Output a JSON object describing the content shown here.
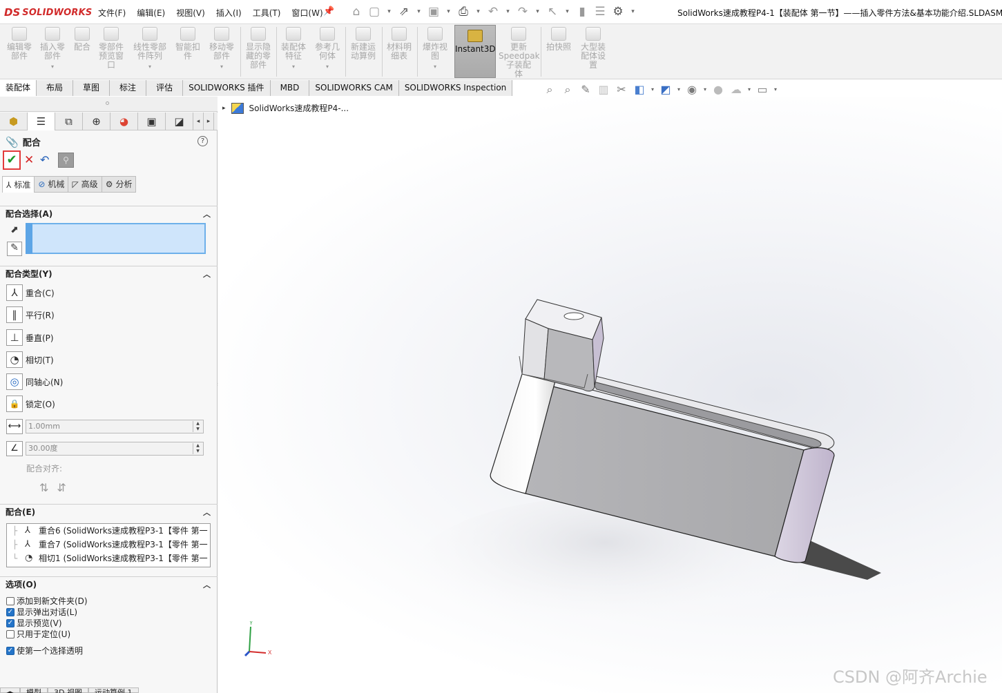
{
  "app": {
    "logo_ds": "DS",
    "logo_brand": "SOLIDWORKS",
    "document_title": "SolidWorks速成教程P4-1【装配体  第一节】——插入零件方法&基本功能介绍.SLDASM"
  },
  "menu": [
    {
      "label": "文件(F)"
    },
    {
      "label": "编辑(E)"
    },
    {
      "label": "视图(V)"
    },
    {
      "label": "插入(I)"
    },
    {
      "label": "工具(T)"
    },
    {
      "label": "窗口(W)"
    }
  ],
  "quickbar_icons": [
    "home-icon",
    "new-doc-icon",
    "open-icon",
    "save-icon",
    "print-icon",
    "undo-icon",
    "redo-icon",
    "select-icon",
    "rebuild-icon",
    "file-props-icon",
    "options-icon"
  ],
  "command_manager": {
    "commands": [
      {
        "label": "编辑零\n部件",
        "icon": "edit-component-icon"
      },
      {
        "label": "插入零\n部件",
        "icon": "insert-component-icon"
      },
      {
        "label": "配合",
        "icon": "mate-icon"
      },
      {
        "label": "零部件\n预览窗\n口",
        "icon": "preview-window-icon"
      },
      {
        "label": "线性零部\n件阵列",
        "icon": "linear-pattern-icon"
      },
      {
        "label": "智能扣\n件",
        "icon": "smart-fastener-icon"
      },
      {
        "label": "移动零\n部件",
        "icon": "move-component-icon"
      },
      {
        "label": "显示隐\n藏的零\n部件",
        "icon": "show-hidden-icon"
      },
      {
        "label": "装配体\n特征",
        "icon": "assembly-feature-icon"
      },
      {
        "label": "参考几\n何体",
        "icon": "reference-geometry-icon"
      },
      {
        "label": "新建运\n动算例",
        "icon": "motion-study-icon"
      },
      {
        "label": "材料明\n细表",
        "icon": "bom-icon"
      },
      {
        "label": "爆炸视\n图",
        "icon": "explode-icon"
      },
      {
        "label": "Instant3D",
        "icon": "instant3d-icon"
      },
      {
        "label": "更新\nSpeedpak\n子装配\n体",
        "icon": "speedpak-icon"
      },
      {
        "label": "拍快照",
        "icon": "snapshot-icon"
      },
      {
        "label": "大型装\n配体设\n置",
        "icon": "large-assembly-icon"
      }
    ],
    "tabs": [
      {
        "label": "装配体",
        "active": true
      },
      {
        "label": "布局"
      },
      {
        "label": "草图"
      },
      {
        "label": "标注"
      },
      {
        "label": "评估"
      },
      {
        "label": "SOLIDWORKS 插件"
      },
      {
        "label": "MBD"
      },
      {
        "label": "SOLIDWORKS CAM"
      },
      {
        "label": "SOLIDWORKS Inspection"
      }
    ]
  },
  "hud_icons": [
    "zoom-fit-icon",
    "zoom-area-icon",
    "previous-view-icon",
    "section-view-icon",
    "dynamic-annotation-icon",
    "view-orientation-icon",
    "display-style-icon",
    "hide-show-icon",
    "edit-appearance-icon",
    "apply-scene-icon",
    "view-settings-icon"
  ],
  "property_manager": {
    "title": "配合",
    "help": "?",
    "ok_symbol": "✔",
    "cancel_symbol": "✕",
    "undo_symbol": "↶",
    "pin_symbol": "⚲",
    "mate_tabs": [
      {
        "label": "标准",
        "active": true,
        "icon": "standard-mates-icon"
      },
      {
        "label": "机械",
        "icon": "mechanical-mates-icon"
      },
      {
        "label": "高级",
        "icon": "advanced-mates-icon"
      },
      {
        "label": "分析",
        "icon": "analysis-icon"
      }
    ],
    "selection_group": "配合选择(A)",
    "type_group": "配合类型(Y)",
    "mate_types": [
      {
        "label": "重合(C)",
        "icon": "coincident-icon",
        "glyph": "⅄"
      },
      {
        "label": "平行(R)",
        "icon": "parallel-icon",
        "glyph": "∥"
      },
      {
        "label": "垂直(P)",
        "icon": "perpendicular-icon",
        "glyph": "⊥"
      },
      {
        "label": "相切(T)",
        "icon": "tangent-icon",
        "glyph": "◔"
      },
      {
        "label": "同轴心(N)",
        "icon": "concentric-icon",
        "glyph": "◎"
      },
      {
        "label": "锁定(O)",
        "icon": "lock-icon",
        "glyph": "🔒"
      }
    ],
    "distance_value": "1.00mm",
    "angle_value": "30.00度",
    "align_label": "配合对齐:",
    "mates_group": "配合(E)",
    "mates": [
      {
        "label": "重合6 (SolidWorks速成教程P3-1【零件 第一"
      },
      {
        "label": "重合7 (SolidWorks速成教程P3-1【零件 第一"
      },
      {
        "label": "相切1 (SolidWorks速成教程P3-1【零件 第一"
      }
    ],
    "options_group": "选项(O)",
    "options": [
      {
        "label": "添加到新文件夹(D)",
        "checked": false
      },
      {
        "label": "显示弹出对话(L)",
        "checked": true
      },
      {
        "label": "显示预览(V)",
        "checked": true
      },
      {
        "label": "只用于定位(U)",
        "checked": false
      },
      {
        "label": "使第一个选择透明",
        "checked": true
      }
    ],
    "bottom_tabs": [
      "模型",
      "3D 视图",
      "运动算例 1"
    ]
  },
  "viewport": {
    "tree_node": "SolidWorks速成教程P4-...",
    "triad": {
      "x": "X",
      "y": "Y"
    },
    "watermark": "CSDN @阿齐Archie"
  }
}
